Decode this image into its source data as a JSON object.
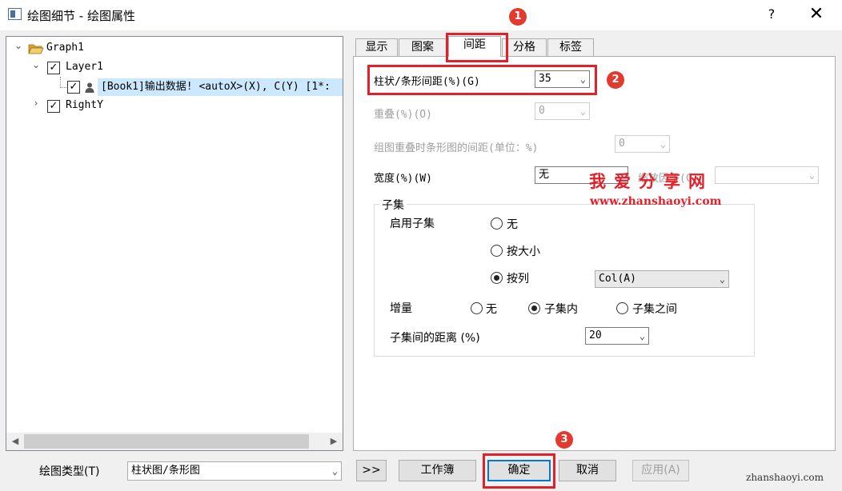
{
  "window": {
    "title": "绘图细节 - 绘图属性",
    "help": "?",
    "close": "✕"
  },
  "tree": {
    "graph": "Graph1",
    "layer": "Layer1",
    "plot": "[Book1]输出数据! <autoX>(X), C(Y) [1*:",
    "righty": "RightY"
  },
  "tabs": [
    "显示",
    "图案",
    "间距",
    "分格",
    "标签"
  ],
  "active_tab": "间距",
  "spacing": {
    "gap_label": "柱状/条形间距(%)(G)",
    "gap_value": "35",
    "overlap_label": "重叠(%)(O)",
    "overlap_value": "0",
    "group_gap_label": "组图重叠时条形图的间距(单位：%)",
    "group_gap_value": "0",
    "width_label": "宽度(%)(W)",
    "width_value": "无",
    "scale_label": "缩放因子(C)",
    "scale_value": ""
  },
  "subset": {
    "group_title": "子集",
    "enable_label": "启用子集",
    "enable_options": [
      "无",
      "按大小",
      "按列"
    ],
    "enable_selected": "按列",
    "column_value": "Col(A)",
    "increment_label": "增量",
    "increment_options": [
      "无",
      "子集内",
      "子集之间"
    ],
    "increment_selected": "子集内",
    "distance_label": "子集间的距离 (%)",
    "distance_value": "20"
  },
  "bottom": {
    "plot_type_label": "绘图类型(T)",
    "plot_type_value": "柱状图/条形图",
    "more_label": ">>",
    "workbook_label": "工作簿",
    "ok_label": "确定",
    "cancel_label": "取消",
    "apply_label": "应用(A)"
  },
  "annotations": {
    "badge1": "1",
    "badge2": "2",
    "badge3": "3"
  },
  "watermark": {
    "title": "我爱分享网",
    "url": "www.zhanshaoyi.com",
    "corner": "zhanshaoyi.com"
  },
  "colors": {
    "highlight": "#e3202a",
    "selection": "#cce8ff",
    "focus": "#0078d7"
  }
}
